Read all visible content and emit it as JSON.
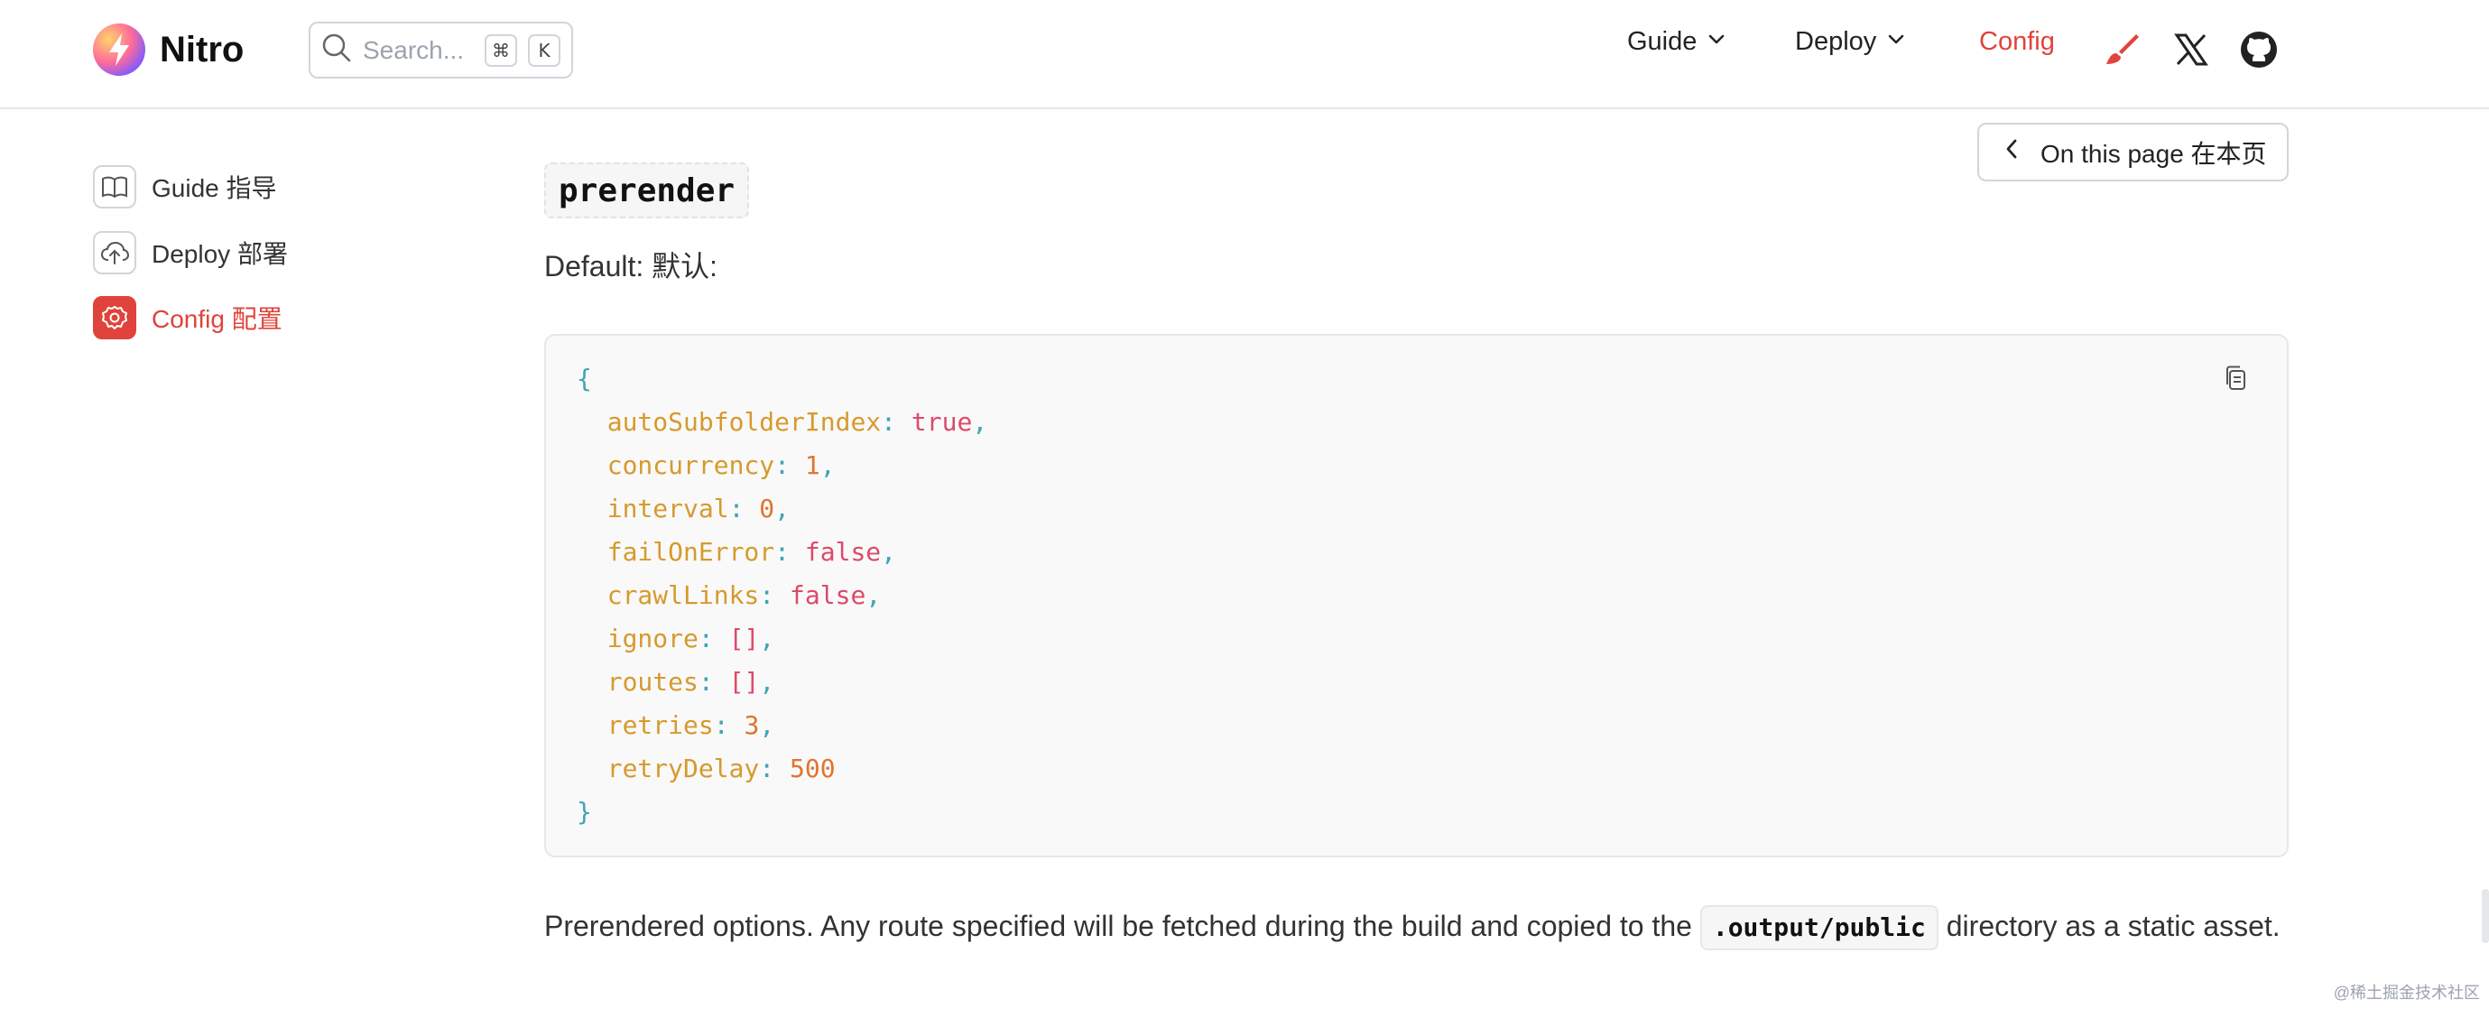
{
  "app": {
    "name": "Nitro"
  },
  "search": {
    "placeholder": "Search...",
    "key1": "⌘",
    "key2": "K"
  },
  "nav": {
    "guide": "Guide",
    "deploy": "Deploy",
    "config": "Config",
    "icons": [
      "brush-icon",
      "x-twitter-icon",
      "github-icon"
    ]
  },
  "sidebar": {
    "items": [
      {
        "label": "Guide  指导",
        "icon": "book-icon"
      },
      {
        "label": "Deploy  部署",
        "icon": "cloud-upload-icon"
      },
      {
        "label": "Config  配置",
        "icon": "gear-icon",
        "active": true
      }
    ]
  },
  "toc": {
    "label": "On this page 在本页"
  },
  "content": {
    "heading": "prerender",
    "default_label": "Default: 默认:",
    "code": {
      "open": "{",
      "close": "}",
      "entries": [
        {
          "key": "autoSubfolderIndex",
          "value": "true",
          "type": "bool"
        },
        {
          "key": "concurrency",
          "value": "1",
          "type": "num"
        },
        {
          "key": "interval",
          "value": "0",
          "type": "num"
        },
        {
          "key": "failOnError",
          "value": "false",
          "type": "bool"
        },
        {
          "key": "crawlLinks",
          "value": "false",
          "type": "bool"
        },
        {
          "key": "ignore",
          "value": "[]",
          "type": "arr"
        },
        {
          "key": "routes",
          "value": "[]",
          "type": "arr"
        },
        {
          "key": "retries",
          "value": "3",
          "type": "num"
        },
        {
          "key": "retryDelay",
          "value": "500",
          "type": "num"
        }
      ]
    },
    "description_before": "Prerendered options. Any route specified will be fetched during the build and copied to the ",
    "description_code": ".output/public",
    "description_after": " directory as a static asset."
  },
  "watermark": "@稀土掘金技术社区",
  "colors": {
    "accent": "#e0433b",
    "key": "#d69a2c",
    "value": "#dd4a68",
    "number": "#e0752e",
    "punct": "#3fa4b5"
  }
}
